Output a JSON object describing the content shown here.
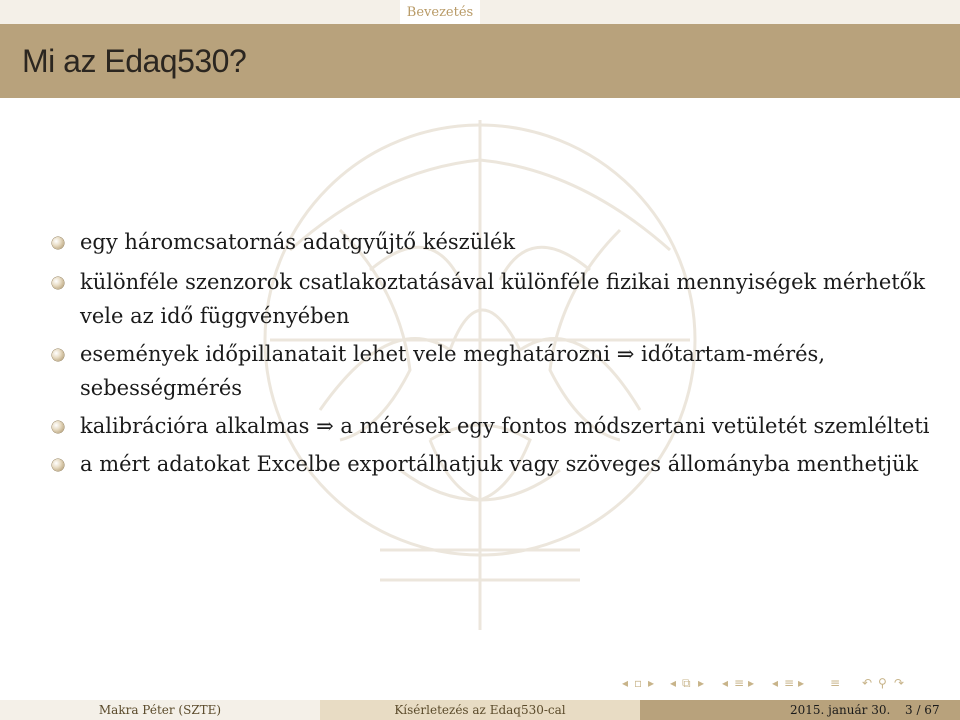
{
  "header": {
    "section": "Bevezetés"
  },
  "frame": {
    "title": "Mi az Edaq530?"
  },
  "bullets": [
    {
      "text": "egy háromcsatornás adatgyűjtő készülék"
    },
    {
      "text": "különféle szenzorok csatlakoztatásával különféle fizikai mennyiségek mérhetők vele az idő függvényében"
    },
    {
      "text": "események időpillanatait lehet vele meghatározni ⇒ időtartam-mérés, sebességmérés"
    },
    {
      "text": "kalibrációra alkalmas ⇒ a mérések egy fontos módszertani vetületét szemlélteti"
    },
    {
      "text": "a mért adatokat Excelbe exportálhatjuk vagy szöveges állományba menthetjük"
    }
  ],
  "footer": {
    "author": "Makra Péter (SZTE)",
    "title": "Kísérletezés az Edaq530-cal",
    "date": "2015. január 30.",
    "page": "3 / 67"
  },
  "colors": {
    "accent": "#b8a27c",
    "light": "#f4f0e8",
    "mid": "#e8dcc4"
  }
}
